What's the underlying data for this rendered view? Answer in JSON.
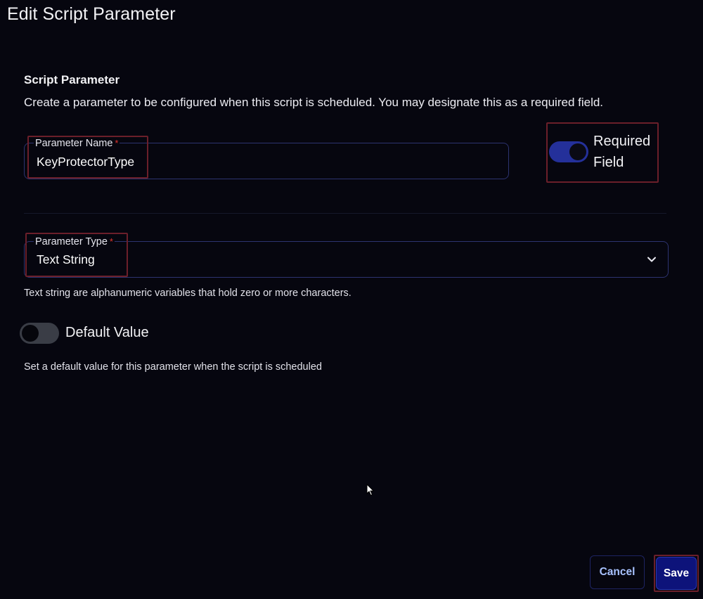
{
  "dialog": {
    "title": "Edit Script Parameter"
  },
  "section": {
    "heading": "Script Parameter",
    "description": "Create a parameter to be configured when this script is scheduled. You may designate this as a required field."
  },
  "parameter_name": {
    "label": "Parameter Name",
    "required_marker": "*",
    "value": "KeyProtectorType"
  },
  "required_field": {
    "label_line1": "Required",
    "label_line2": "Field",
    "checked": true
  },
  "parameter_type": {
    "label": "Parameter Type",
    "required_marker": "*",
    "selected": "Text String",
    "helper": "Text string are alphanumeric variables that hold zero or more characters.",
    "icon": "chevron-down-icon"
  },
  "default_value": {
    "label": "Default Value",
    "checked": false,
    "helper": "Set a default value for this parameter when the script is scheduled"
  },
  "footer": {
    "cancel_label": "Cancel",
    "save_label": "Save"
  },
  "colors": {
    "background": "#06060f",
    "field_border": "#2d3370",
    "toggle_on": "#24309a",
    "toggle_off": "#3a3d46",
    "required_marker": "#e0342e",
    "save_button": "#0d137a",
    "cancel_text": "#a8c2ff",
    "highlight_box": "#6b1f2a"
  }
}
